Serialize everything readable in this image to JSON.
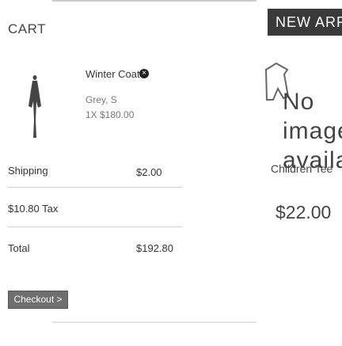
{
  "cart": {
    "title": "CART",
    "item": {
      "name": "Winter Coat",
      "variant": "Grey, S",
      "qty_price": "1X $180.00"
    },
    "shipping": {
      "label": "Shipping",
      "value": "$2.00"
    },
    "tax": {
      "label": "$10.80 Tax"
    },
    "total": {
      "label": "Total",
      "value": "$192.80"
    },
    "checkout_label": "Checkout >"
  },
  "product_panel": {
    "new_arrivals_label": "NEW ARRIVALS",
    "no_image_text": "No image available",
    "product_name": "Children Tee",
    "product_price": "$22.00"
  },
  "colors": {
    "accent_dark": "#3a3a3a",
    "checkout_bg": "#6f6f6f",
    "text": "#333333"
  }
}
